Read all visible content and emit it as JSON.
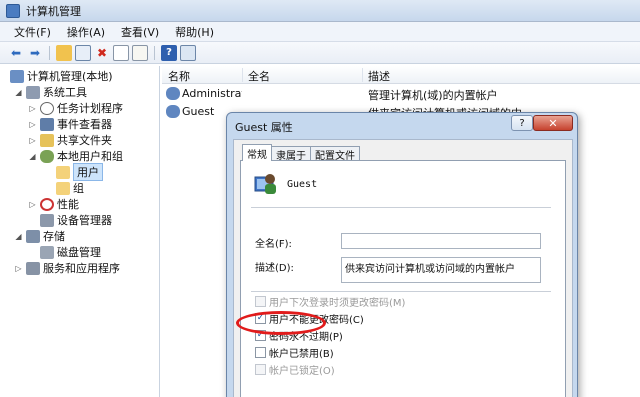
{
  "window": {
    "title": "计算机管理"
  },
  "menu": [
    "文件(F)",
    "操作(A)",
    "查看(V)",
    "帮助(H)"
  ],
  "toolbar_icons": [
    "back-icon",
    "forward-icon",
    "up-folder-icon",
    "show-tree-icon",
    "delete-icon",
    "properties-icon",
    "export-icon",
    "help-icon",
    "console-icon"
  ],
  "tree": {
    "root": "计算机管理(本地)",
    "system_tools": "系统工具",
    "task_scheduler": "任务计划程序",
    "event_viewer": "事件查看器",
    "shared_folders": "共享文件夹",
    "local_users_groups": "本地用户和组",
    "users": "用户",
    "groups": "组",
    "performance": "性能",
    "device_manager": "设备管理器",
    "storage": "存储",
    "disk_management": "磁盘管理",
    "services_apps": "服务和应用程序"
  },
  "list": {
    "columns": [
      "名称",
      "全名",
      "描述"
    ],
    "rows": [
      {
        "name": "Administrat...",
        "fullname": "",
        "desc": "管理计算机(域)的内置帐户"
      },
      {
        "name": "Guest",
        "fullname": "",
        "desc": "供来宾访问计算机或访问域的内"
      }
    ]
  },
  "dialog": {
    "title": "Guest 属性",
    "help": "?",
    "close": "✕",
    "tabs": [
      "常规",
      "隶属于",
      "配置文件"
    ],
    "username": "Guest",
    "fullname_label": "全名(F):",
    "fullname_value": "",
    "desc_label": "描述(D):",
    "desc_value": "供来宾访问计算机或访问域的内置帐户",
    "checkboxes": [
      {
        "label": "用户下次登录时须更改密码(M)",
        "checked": false,
        "disabled": true
      },
      {
        "label": "用户不能更改密码(C)",
        "checked": true,
        "disabled": false
      },
      {
        "label": "密码永不过期(P)",
        "checked": true,
        "disabled": false
      },
      {
        "label": "帐户已禁用(B)",
        "checked": false,
        "disabled": false
      },
      {
        "label": "帐户已锁定(O)",
        "checked": false,
        "disabled": true
      }
    ]
  },
  "colors": {
    "highlight_ring": "#e11b1b",
    "selection": "#cde4fb"
  }
}
